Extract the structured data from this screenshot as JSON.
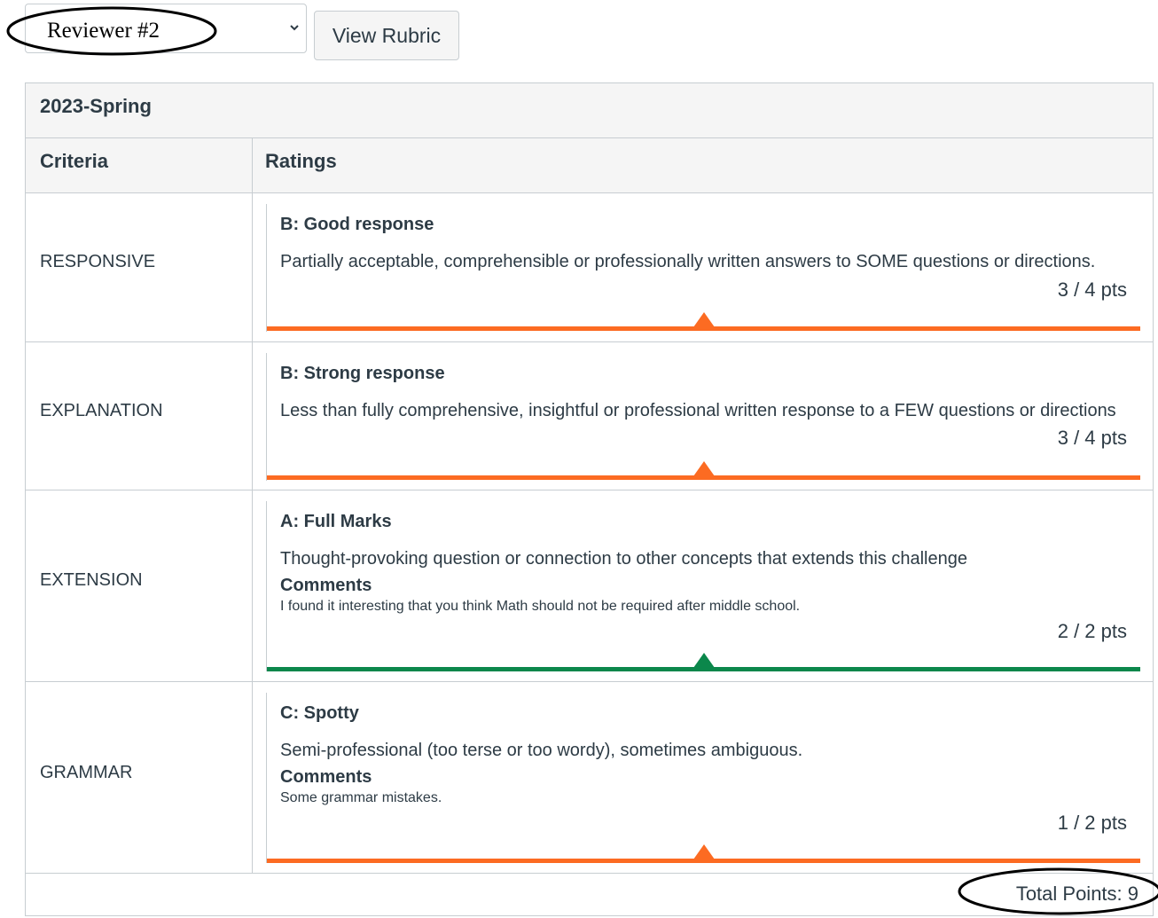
{
  "reviewer_select": {
    "value": "Reviewer #2"
  },
  "view_rubric_button": {
    "label": "View Rubric"
  },
  "rubric": {
    "title": "2023-Spring",
    "headers": {
      "criteria": "Criteria",
      "ratings": "Ratings"
    },
    "rows": [
      {
        "criterion": "RESPONSIVE",
        "rating_title": "B: Good response",
        "rating_desc": "Partially acceptable, comprehensible or professionally written answers to SOME questions or directions.",
        "points": "3 / 4 pts",
        "bar_color": "#fc6b22"
      },
      {
        "criterion": "EXPLANATION",
        "rating_title": "B: Strong response",
        "rating_desc": "Less than fully comprehensive, insightful or professional written response to a FEW questions or directions",
        "points": "3 / 4 pts",
        "bar_color": "#fc6b22"
      },
      {
        "criterion": "EXTENSION",
        "rating_title": "A: Full Marks",
        "rating_desc": "Thought-provoking question or connection to other concepts that extends this challenge",
        "comments_label": "Comments",
        "comment": "I found it interesting that you think Math should not be required after middle school.",
        "points": "2 / 2 pts",
        "bar_color": "#0b874b"
      },
      {
        "criterion": "GRAMMAR",
        "rating_title": "C: Spotty",
        "rating_desc": "Semi-professional (too terse or too wordy), sometimes ambiguous.",
        "comments_label": "Comments",
        "comment": "Some grammar mistakes.",
        "points": "1 / 2 pts",
        "bar_color": "#fc6b22"
      }
    ],
    "total": "Total Points: 9"
  }
}
